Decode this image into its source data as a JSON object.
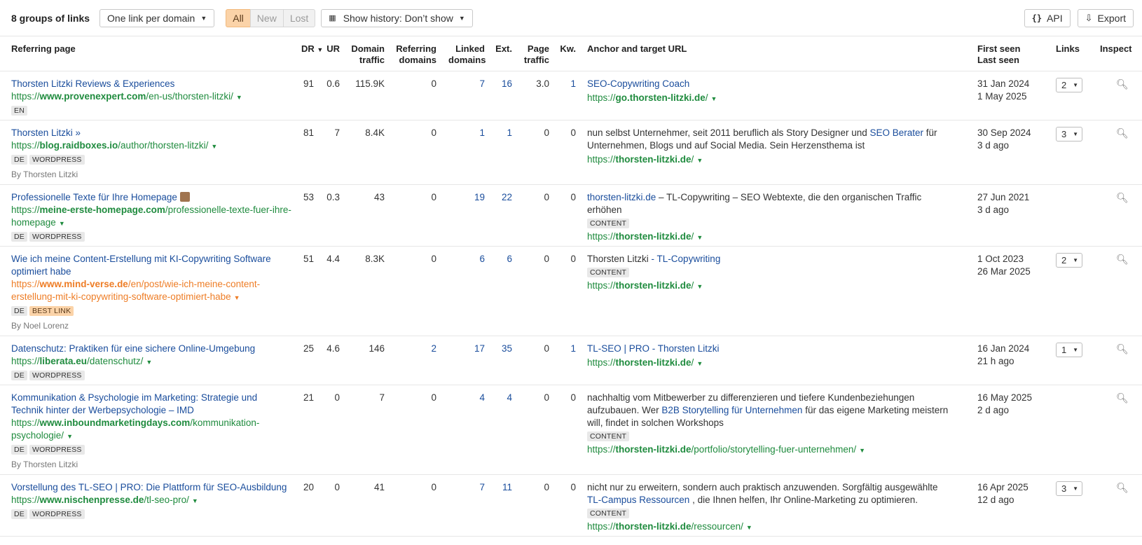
{
  "toolbar": {
    "title": "8 groups of links",
    "filter_label": "One link per domain",
    "segments": [
      "All",
      "New",
      "Lost"
    ],
    "history_label": "Show history: Don’t show",
    "api_label": "API",
    "export_label": "Export"
  },
  "columns": {
    "referring_page": "Referring page",
    "dr": "DR",
    "ur": "UR",
    "domain_traffic": "Domain traffic",
    "referring_domains": "Referring domains",
    "linked_domains": "Linked domains",
    "ext": "Ext.",
    "page_traffic": "Page traffic",
    "kw": "Kw.",
    "anchor": "Anchor and target URL",
    "first_seen": "First seen",
    "last_seen": "Last seen",
    "links": "Links",
    "inspect": "Inspect"
  },
  "rows": [
    {
      "title": "Thorsten Litzki Reviews & Experiences",
      "url_pre": "https://",
      "url_domain": "www.provenexpert.com",
      "url_path": "/en-us/thorsten-litzki/",
      "tags": [
        "EN"
      ],
      "byline": "",
      "dr": "91",
      "ur": "0.6",
      "domain_traffic": "115.9K",
      "referring_domains": "0",
      "linked_domains": "7",
      "ext": "16",
      "page_traffic": "3.0",
      "kw": "1",
      "anchor_pre": "",
      "anchor_link": "SEO-Copywriting Coach",
      "anchor_post": "",
      "anchor_tag": "",
      "target_pre": "https://",
      "target_domain": "go.thorsten-litzki.de",
      "target_path": "/",
      "first_seen": "31 Jan 2024",
      "last_seen": "1 May 2025",
      "links": "2"
    },
    {
      "title": "Thorsten Litzki »",
      "url_pre": "https://",
      "url_domain": "blog.raidboxes.io",
      "url_path": "/author/thorsten-litzki/",
      "tags": [
        "DE",
        "WORDPRESS"
      ],
      "byline": "By Thorsten Litzki",
      "dr": "81",
      "ur": "7",
      "domain_traffic": "8.4K",
      "referring_domains": "0",
      "linked_domains": "1",
      "ext": "1",
      "page_traffic": "0",
      "kw": "0",
      "anchor_pre": "nun selbst Unternehmer, seit 2011 beruflich als Story Designer und ",
      "anchor_link": "SEO Berater",
      "anchor_post": " für Unternehmen, Blogs und auf Social Media. Sein Herzensthema ist",
      "anchor_tag": "",
      "target_pre": "https://",
      "target_domain": "thorsten-litzki.de",
      "target_path": "/",
      "first_seen": "30 Sep 2024",
      "last_seen": "3 d ago",
      "links": "3"
    },
    {
      "title": "Professionelle Texte für Ihre Homepage",
      "url_pre": "https://",
      "url_domain": "meine-erste-homepage.com",
      "url_path": "/professionelle-texte-fuer-ihre-homepage",
      "tags": [
        "DE",
        "WORDPRESS"
      ],
      "byline": "",
      "dr": "53",
      "ur": "0.3",
      "domain_traffic": "43",
      "referring_domains": "0",
      "linked_domains": "19",
      "ext": "22",
      "page_traffic": "0",
      "kw": "0",
      "anchor_pre": "",
      "anchor_link": "thorsten-litzki.de",
      "anchor_post": " – TL-Copywriting – SEO Webtexte, die den organischen Traffic erhöhen",
      "anchor_tag": "CONTENT",
      "target_pre": "https://",
      "target_domain": "thorsten-litzki.de",
      "target_path": "/",
      "first_seen": "27 Jun 2021",
      "last_seen": "3 d ago",
      "links": ""
    },
    {
      "title": "Wie ich meine Content-Erstellung mit KI-Copywriting Software optimiert habe",
      "url_pre": "https://",
      "url_domain": "www.mind-verse.de",
      "url_path": "/en/post/wie-ich-meine-content-erstellung-mit-ki-copywriting-software-optimiert-habe",
      "tags": [
        "DE",
        "BEST LINK"
      ],
      "byline": "By Noel Lorenz",
      "dr": "51",
      "ur": "4.4",
      "domain_traffic": "8.3K",
      "referring_domains": "0",
      "linked_domains": "6",
      "ext": "6",
      "page_traffic": "0",
      "kw": "0",
      "anchor_pre": "Thorsten Litzki ",
      "anchor_link": "- TL-Copywriting",
      "anchor_post": "",
      "anchor_tag": "CONTENT",
      "target_pre": "https://",
      "target_domain": "thorsten-litzki.de",
      "target_path": "/",
      "first_seen": "1 Oct 2023",
      "last_seen": "26 Mar 2025",
      "links": "2"
    },
    {
      "title": "Datenschutz: Praktiken für eine sichere Online-Umgebung",
      "url_pre": "https://",
      "url_domain": "liberata.eu",
      "url_path": "/datenschutz/",
      "tags": [
        "DE",
        "WORDPRESS"
      ],
      "byline": "",
      "dr": "25",
      "ur": "4.6",
      "domain_traffic": "146",
      "referring_domains": "2",
      "linked_domains": "17",
      "ext": "35",
      "page_traffic": "0",
      "kw": "1",
      "anchor_pre": "",
      "anchor_link": "TL-SEO | PRO - Thorsten Litzki",
      "anchor_post": "",
      "anchor_tag": "",
      "target_pre": "https://",
      "target_domain": "thorsten-litzki.de",
      "target_path": "/",
      "first_seen": "16 Jan 2024",
      "last_seen": "21 h ago",
      "links": "1"
    },
    {
      "title": "Kommunikation & Psychologie im Marketing: Strategie und Technik hinter der Werbepsychologie – IMD",
      "url_pre": "https://",
      "url_domain": "www.inboundmarketingdays.com",
      "url_path": "/kommunikation-psychologie/",
      "tags": [
        "DE",
        "WORDPRESS"
      ],
      "byline": "By Thorsten Litzki",
      "dr": "21",
      "ur": "0",
      "domain_traffic": "7",
      "referring_domains": "0",
      "linked_domains": "4",
      "ext": "4",
      "page_traffic": "0",
      "kw": "0",
      "anchor_pre": "nachhaltig vom Mitbewerber zu differenzieren und tiefere Kundenbeziehungen aufzubauen. Wer ",
      "anchor_link": "B2B Storytelling für Unternehmen",
      "anchor_post": " für das eigene Marketing meistern will, findet in solchen Workshops",
      "anchor_tag": "CONTENT",
      "target_pre": "https://",
      "target_domain": "thorsten-litzki.de",
      "target_path": "/portfolio/storytelling-fuer-unternehmen/",
      "first_seen": "16 May 2025",
      "last_seen": "2 d ago",
      "links": ""
    },
    {
      "title": "Vorstellung des TL-SEO | PRO: Die Plattform für SEO-Ausbildung",
      "url_pre": "https://",
      "url_domain": "www.nischenpresse.de",
      "url_path": "/tl-seo-pro/",
      "tags": [
        "DE",
        "WORDPRESS"
      ],
      "byline": "",
      "dr": "20",
      "ur": "0",
      "domain_traffic": "41",
      "referring_domains": "0",
      "linked_domains": "7",
      "ext": "11",
      "page_traffic": "0",
      "kw": "0",
      "anchor_pre": "nicht nur zu erweitern, sondern auch praktisch anzuwenden. Sorgfältig ausgewählte ",
      "anchor_link": "TL-Campus Ressourcen",
      "anchor_post": " , die Ihnen helfen, Ihr Online-Marketing zu optimieren.",
      "anchor_tag": "CONTENT",
      "target_pre": "https://",
      "target_domain": "thorsten-litzki.de",
      "target_path": "/ressourcen/",
      "first_seen": "16 Apr 2025",
      "last_seen": "12 d ago",
      "links": "3"
    }
  ]
}
